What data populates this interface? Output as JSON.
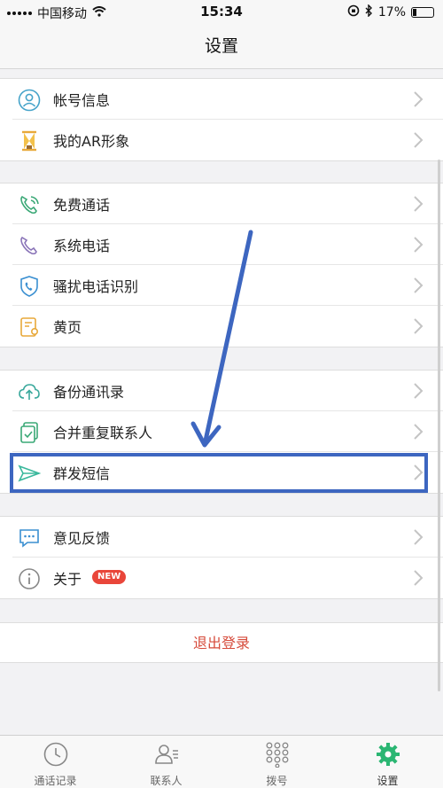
{
  "status_bar": {
    "carrier": "中国移动",
    "time": "15:34",
    "battery": "17%"
  },
  "nav": {
    "title": "设置"
  },
  "groups": [
    {
      "items": [
        {
          "label": "帐号信息",
          "icon": "person-icon"
        },
        {
          "label": "我的AR形象",
          "icon": "hourglass-avatar-icon"
        }
      ]
    },
    {
      "items": [
        {
          "label": "免费通话",
          "icon": "phone-wifi-icon"
        },
        {
          "label": "系统电话",
          "icon": "phone-icon"
        },
        {
          "label": "骚扰电话识别",
          "icon": "shield-phone-icon"
        },
        {
          "label": "黄页",
          "icon": "yellow-page-icon"
        }
      ]
    },
    {
      "items": [
        {
          "label": "备份通讯录",
          "icon": "cloud-upload-icon"
        },
        {
          "label": "合并重复联系人",
          "icon": "merge-contacts-icon"
        },
        {
          "label": "群发短信",
          "icon": "send-plane-icon"
        }
      ]
    },
    {
      "items": [
        {
          "label": "意见反馈",
          "icon": "feedback-chat-icon"
        },
        {
          "label": "关于",
          "icon": "info-icon",
          "badge": "NEW"
        }
      ]
    }
  ],
  "logout": {
    "label": "退出登录"
  },
  "tabs": [
    {
      "label": "通话记录",
      "icon": "clock-icon"
    },
    {
      "label": "联系人",
      "icon": "contacts-icon"
    },
    {
      "label": "拨号",
      "icon": "dialpad-icon"
    },
    {
      "label": "设置",
      "icon": "gear-icon",
      "active": true
    }
  ],
  "colors": {
    "accent_green": "#2bb673",
    "logout_red": "#d64a3a",
    "highlight_blue": "#3d66c0",
    "badge_red": "#e9463a"
  }
}
